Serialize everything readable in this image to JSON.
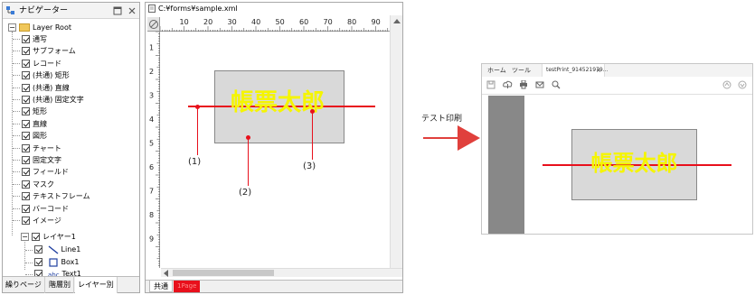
{
  "navigator": {
    "title": "ナビゲーター",
    "root": "Layer Root",
    "items": [
      "通写",
      "サブフォーム",
      "レコード",
      "(共通) 矩形",
      "(共通) 直線",
      "(共通) 固定文字",
      "矩形",
      "直線",
      "図形",
      "チャート",
      "固定文字",
      "フィールド",
      "マスク",
      "テキストフレーム",
      "バーコード",
      "イメージ"
    ],
    "layer": "レイヤー1",
    "layer_children": [
      "Line1",
      "Box1",
      "Text1"
    ],
    "tabs": [
      "繰りページ",
      "階層別",
      "レイヤー別"
    ]
  },
  "designer": {
    "file_path": "C:¥forms¥sample.xml",
    "ruler_top": [
      "10",
      "20",
      "30",
      "40",
      "50",
      "60",
      "70",
      "80",
      "90"
    ],
    "ruler_left": [
      "1",
      "2",
      "3",
      "4",
      "5",
      "6",
      "7",
      "8",
      "9"
    ],
    "box_text": "帳票太郎",
    "callouts": [
      "(1)",
      "(2)",
      "(3)"
    ],
    "tabs": [
      "共通",
      "1Page"
    ]
  },
  "arrow": {
    "label": "テスト印刷"
  },
  "preview": {
    "tabs": [
      "ホーム",
      "ツール",
      "testPrint_914521979..."
    ],
    "close": "×",
    "box_text": "帳票太郎"
  },
  "colors": {
    "red": "#e8101c",
    "box_fill": "#d9d9d9",
    "text_yellow": "#f5f500",
    "arrow": "#e0403c"
  }
}
